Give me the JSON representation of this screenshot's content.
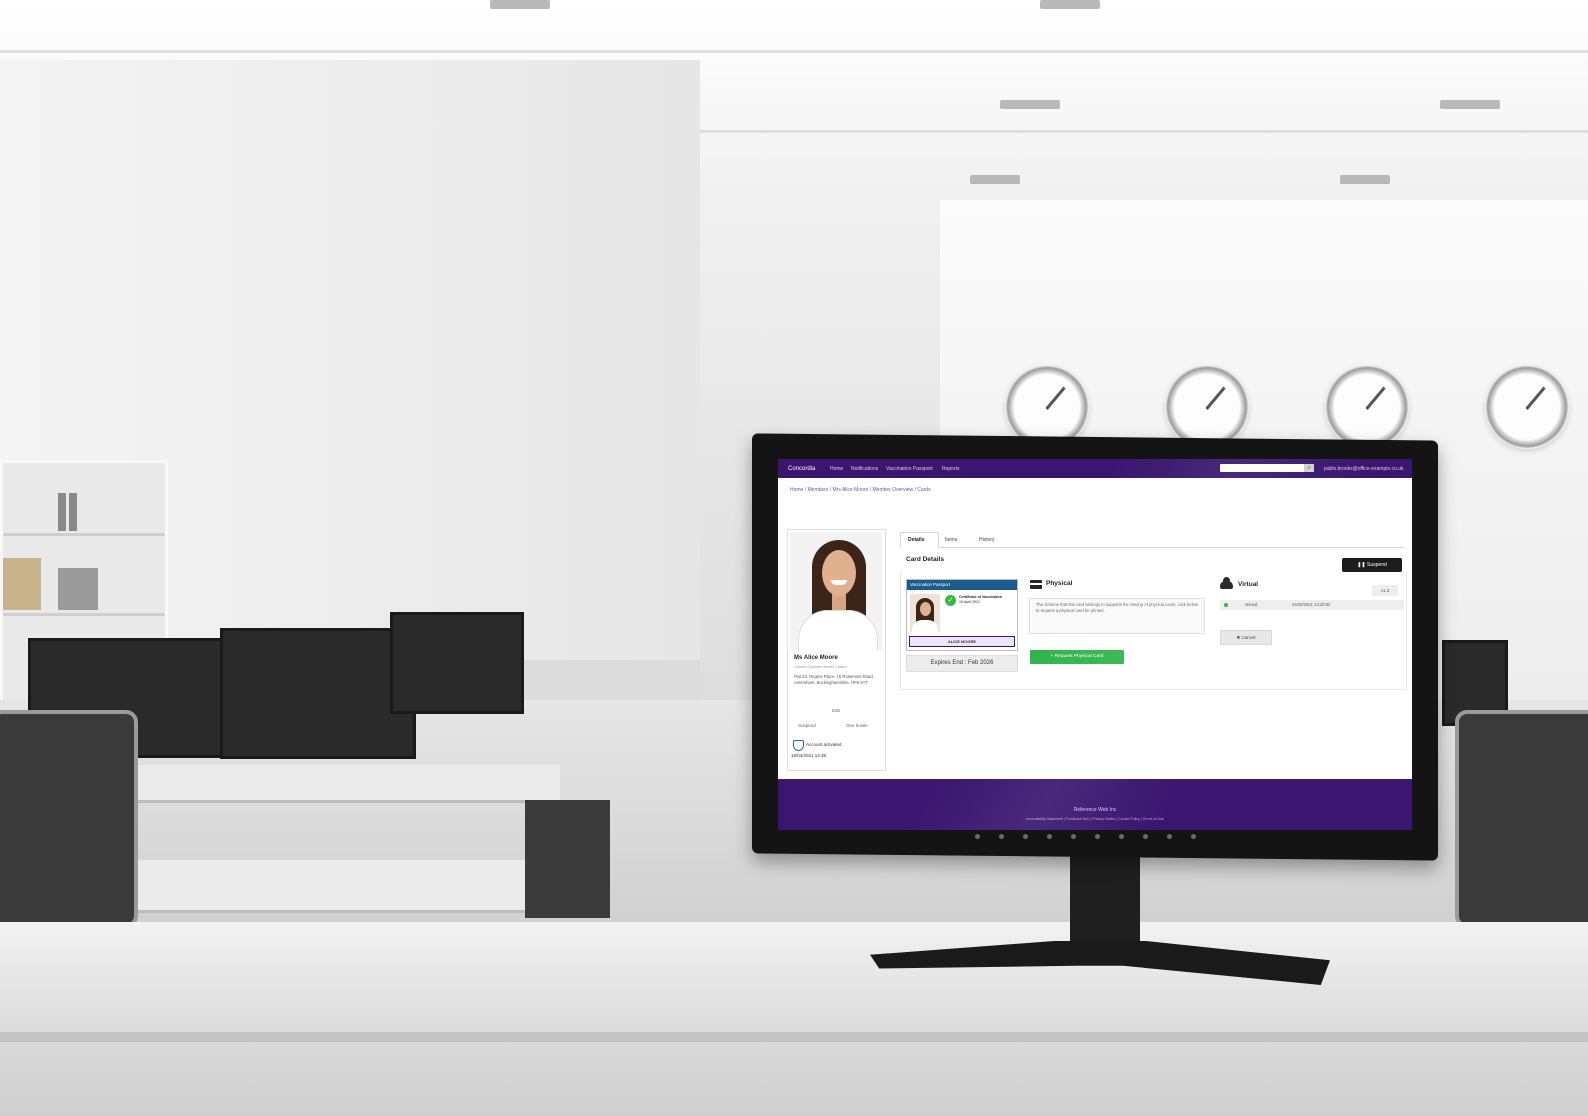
{
  "nav": {
    "logo": "Concordia",
    "items": [
      "Home",
      "Notifications",
      "Vaccination Passport",
      "Reports"
    ],
    "search_placeholder": "",
    "user_email": "pablo.brooks@office-example.co.uk"
  },
  "breadcrumb": "Home / Members / Mrs Alice Moore / Member Overview / Cards",
  "profile": {
    "name": "Ms Alice Moore",
    "subtitle": "Citizen Optimal Health Centre",
    "address": "Flat 23, Regent Place, 15 Rosemont Road, Amersham, Buckinghamshire, HP6 5YT",
    "edit_label": "Edit",
    "suspend_label": "Suspend",
    "onehustle_label": "One hustle",
    "account_status": "Account activated",
    "activated_date": "19/04/2021   14:38"
  },
  "tabs": [
    "Details",
    "Items",
    "History"
  ],
  "card_details": {
    "title": "Card Details",
    "suspend_button": "Suspend",
    "idcard": {
      "header": "Vaccination Passport",
      "cert_text": "Certificate of Vaccination",
      "cert_date": "19 April 2021",
      "holder_name": "ALICE MOORE"
    },
    "expiry": "Expires End : Feb 2026"
  },
  "physical": {
    "title": "Physical",
    "note": "The scheme that this card belongs to supports the issuing of physical cards, click below to request a physical card be printed.",
    "request_button": "+ Request Physical Card"
  },
  "virtual": {
    "title": "Virtual",
    "version": "v1.3",
    "status": "Issued",
    "timestamp": "24/03/2021 14:30:02",
    "cancel_button": "✖ Cancel"
  },
  "footer": {
    "title": "Reference Web Inc",
    "links": "Accessibility Statement  |  Feedback Hub  |  Privacy Notice  |  Cookie Policy  |  Terms of Use"
  },
  "colors": {
    "brand_purple": "#3a1670",
    "success_green": "#2fb24a",
    "card_blue": "#1c5c8d"
  }
}
